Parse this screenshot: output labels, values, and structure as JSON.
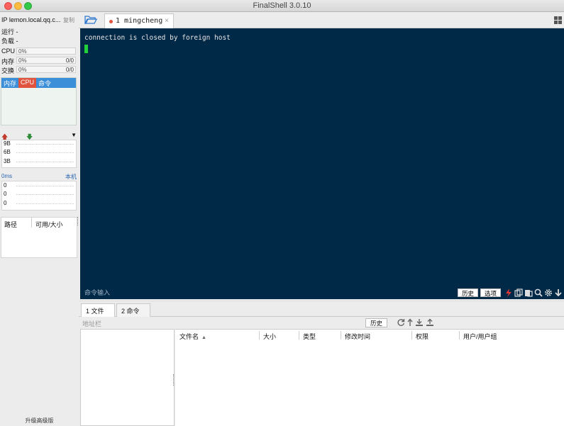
{
  "window": {
    "title": "FinalShell 3.0.10"
  },
  "sidebar": {
    "ip_label": "IP lemon.local.qq.c...",
    "copy_label": "复制",
    "run_label": "运行 -",
    "load_label": "负载 -",
    "meters": [
      {
        "label": "CPU",
        "pct": "0%",
        "value": ""
      },
      {
        "label": "内存",
        "pct": "0%",
        "value": "0/0"
      },
      {
        "label": "交换",
        "pct": "0%",
        "value": "0/0"
      }
    ],
    "process_tabs": [
      "内存",
      "CPU",
      "命令"
    ],
    "net": {
      "ticks": [
        "9B",
        "6B",
        "3B"
      ]
    },
    "ping": {
      "latency": "0ms",
      "host": "本机",
      "ticks": [
        "0",
        "0",
        "0"
      ]
    },
    "disk": {
      "col_path": "路径",
      "col_size": "可用/大小"
    },
    "upgrade_label": "升级高级版"
  },
  "tabs": [
    {
      "label": "1 mingcheng",
      "close": "×"
    }
  ],
  "terminal": {
    "lines": [
      "connection is closed by foreign host"
    ],
    "command_input_label": "命令输入",
    "history_label": "历史",
    "options_label": "选项"
  },
  "bottom_tabs": [
    {
      "label": "1 文件"
    },
    {
      "label": "2 命令"
    }
  ],
  "file_browser": {
    "address_placeholder": "地址栏",
    "history_label": "历史",
    "columns": [
      "文件名",
      "大小",
      "类型",
      "修改时间",
      "权限",
      "用户/用户组"
    ]
  },
  "colors": {
    "terminal_bg": "#002847",
    "cursor": "#22d13a",
    "process_header": "#3b8ed8",
    "process_cpu": "#e0533d"
  }
}
